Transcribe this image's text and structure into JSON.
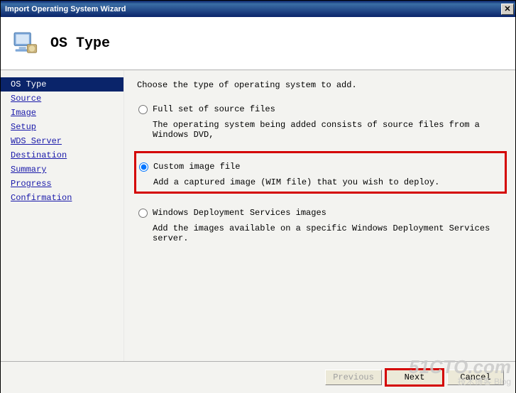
{
  "window": {
    "title": "Import Operating System Wizard"
  },
  "header": {
    "page_title": "OS Type"
  },
  "sidebar": {
    "items": [
      {
        "label": "OS Type",
        "selected": true
      },
      {
        "label": "Source",
        "selected": false
      },
      {
        "label": "Image",
        "selected": false
      },
      {
        "label": "Setup",
        "selected": false
      },
      {
        "label": "WDS Server",
        "selected": false
      },
      {
        "label": "Destination",
        "selected": false
      },
      {
        "label": "Summary",
        "selected": false
      },
      {
        "label": "Progress",
        "selected": false
      },
      {
        "label": "Confirmation",
        "selected": false
      }
    ]
  },
  "main": {
    "instruction": "Choose the type of operating system to add.",
    "options": [
      {
        "label": "Full set of source files",
        "desc": "The operating system being added consists of source files from a Windows DVD,",
        "checked": false,
        "highlighted": false
      },
      {
        "label": "Custom image file",
        "desc": "Add a captured image (WIM file) that you wish to deploy.",
        "checked": true,
        "highlighted": true
      },
      {
        "label": "Windows Deployment Services images",
        "desc": "Add the images available on a specific Windows Deployment Services server.",
        "checked": false,
        "highlighted": false
      }
    ]
  },
  "footer": {
    "previous": "Previous",
    "next": "Next",
    "cancel": "Cancel"
  },
  "watermark": {
    "line1": "51CTO.com",
    "line2": "技术博客 Blog"
  }
}
